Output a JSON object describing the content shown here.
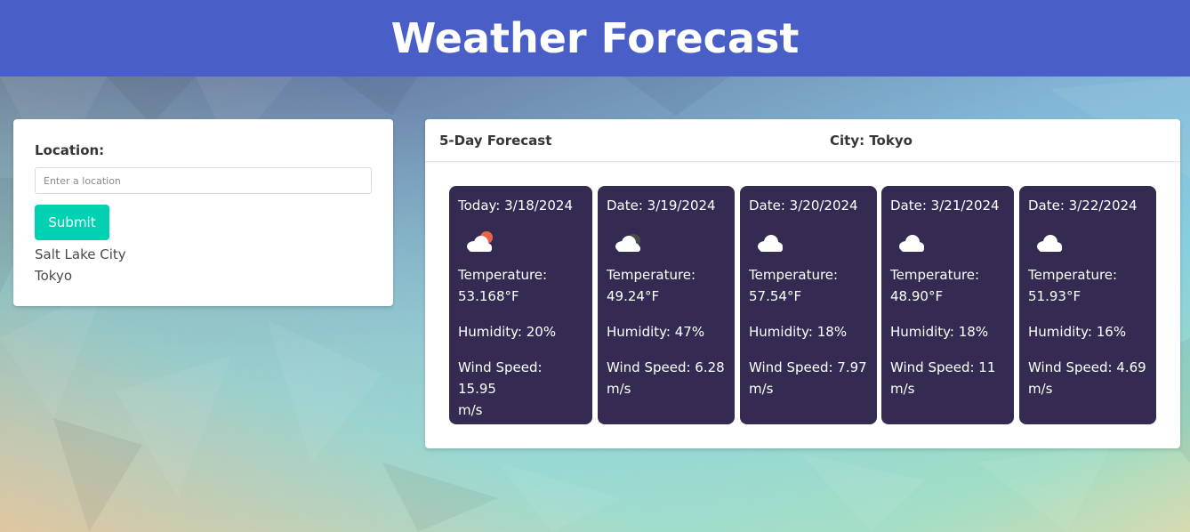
{
  "header": {
    "title": "Weather Forecast"
  },
  "search": {
    "label": "Location:",
    "placeholder": "Enter a location",
    "value": "",
    "submit_label": "Submit",
    "history": [
      "Salt Lake City",
      "Tokyo"
    ]
  },
  "forecast": {
    "heading": "5-Day Forecast",
    "city": "City: Tokyo",
    "days": [
      {
        "date": "Today: 3/18/2024",
        "icon": "cloud-sun-icon",
        "temp_label": "Temperature:",
        "temp": "53.168°F",
        "humidity": "Humidity: 20%",
        "wind_1": "Wind Speed: 15.95",
        "wind_2": "m/s"
      },
      {
        "date": "Date: 3/19/2024",
        "icon": "cloud-dark-icon",
        "temp_label": "Temperature:",
        "temp": "49.24°F",
        "humidity": "Humidity: 47%",
        "wind_1": "Wind Speed: 6.28",
        "wind_2": "m/s"
      },
      {
        "date": "Date: 3/20/2024",
        "icon": "cloud-icon",
        "temp_label": "Temperature:",
        "temp": "57.54°F",
        "humidity": "Humidity: 18%",
        "wind_1": "Wind Speed: 7.97",
        "wind_2": "m/s"
      },
      {
        "date": "Date: 3/21/2024",
        "icon": "cloud-icon",
        "temp_label": "Temperature:",
        "temp": "48.90°F",
        "humidity": "Humidity: 18%",
        "wind_1": "Wind Speed: 11",
        "wind_2": "m/s"
      },
      {
        "date": "Date: 3/22/2024",
        "icon": "cloud-icon",
        "temp_label": "Temperature:",
        "temp": "51.93°F",
        "humidity": "Humidity: 16%",
        "wind_1": "Wind Speed: 4.69",
        "wind_2": "m/s"
      }
    ]
  },
  "colors": {
    "header_bg": "#4a5ec8",
    "submit_bg": "#00d1b2",
    "day_card_bg": "#342a52"
  }
}
